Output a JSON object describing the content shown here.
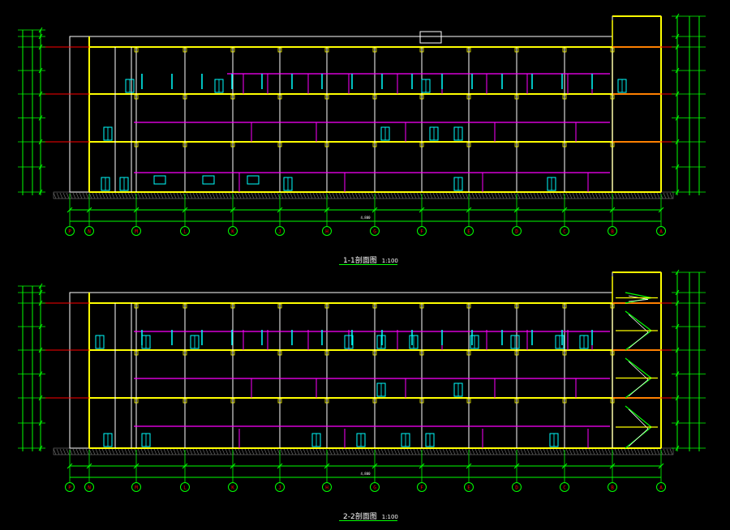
{
  "colors": {
    "background": "#000000",
    "frame": "#ffff00",
    "interior": "#ffffff",
    "partition": "#ff00ff",
    "axis_red": "#ff0000",
    "dimension": "#00ff00",
    "door": "#00ffff",
    "hatch": "#777777"
  },
  "axis_labels": [
    "P",
    "N",
    "M",
    "L",
    "K",
    "J",
    "H",
    "G",
    "F",
    "E",
    "D",
    "C",
    "B",
    "A"
  ],
  "sections": [
    {
      "id": "section-1",
      "title": "1-1剖面图",
      "scale": "1:100",
      "total_dim": "4,800",
      "stair": false
    },
    {
      "id": "section-2",
      "title": "2-2剖面图",
      "scale": "1:100",
      "total_dim": "4,800",
      "stair": true
    }
  ]
}
